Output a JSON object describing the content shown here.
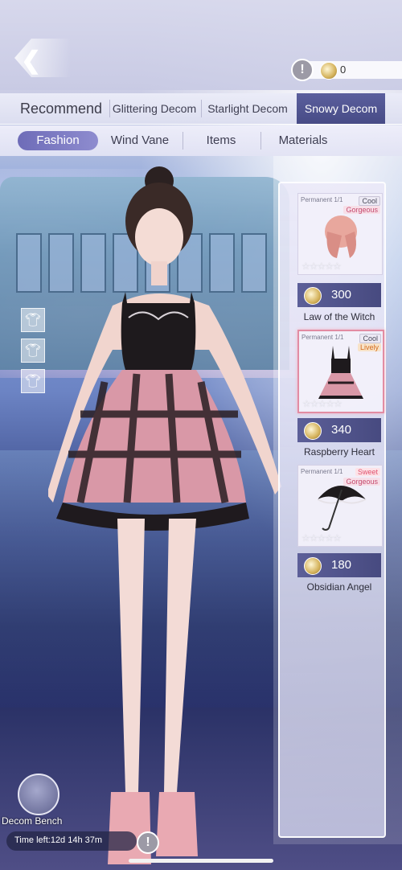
{
  "header": {
    "currency_value": "0"
  },
  "category_tabs": [
    {
      "label": "Recommend",
      "active": false
    },
    {
      "label": "Glittering Decom",
      "active": false
    },
    {
      "label": "Starlight Decom",
      "active": false
    },
    {
      "label": "Snowy Decom",
      "active": true
    }
  ],
  "sub_tabs": [
    {
      "label": "Fashion",
      "active": true
    },
    {
      "label": "Wind Vane",
      "active": false
    },
    {
      "label": "Items",
      "active": false
    },
    {
      "label": "Materials",
      "active": false
    }
  ],
  "items": [
    {
      "permanence": "Permanent 1/1",
      "tags": [
        "Cool",
        "Gorgeous"
      ],
      "stars": "☆☆☆☆☆",
      "price": "300",
      "name": "Law of the Witch",
      "selected": false
    },
    {
      "permanence": "Permanent 1/1",
      "tags": [
        "Cool",
        "Lively"
      ],
      "stars": "☆☆☆☆☆",
      "price": "340",
      "name": "Raspberry Heart",
      "selected": true
    },
    {
      "permanence": "Permanent 1/1",
      "tags": [
        "Sweet",
        "Gorgeous"
      ],
      "stars": "☆☆☆☆☆",
      "price": "180",
      "name": "Obsidian Angel",
      "selected": false
    }
  ],
  "footer": {
    "decom_bench_label": "Decom Bench",
    "time_left": "Time left:12d 14h 37m"
  },
  "colors": {
    "active_tab": "#474b86",
    "price_bar": "#5c5f98",
    "selected_border": "#e28ca3"
  }
}
